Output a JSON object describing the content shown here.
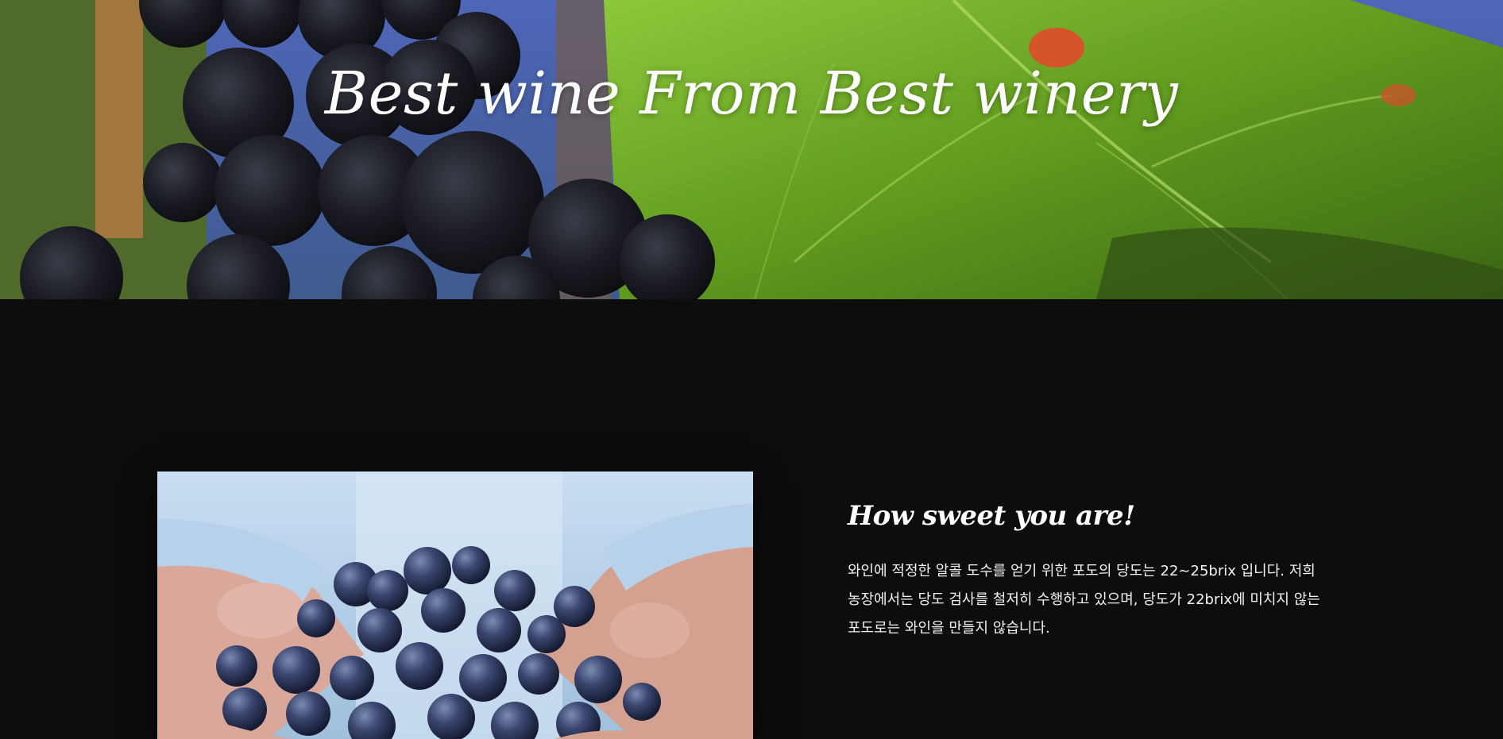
{
  "hero": {
    "title": "Best wine From Best winery"
  },
  "feature": {
    "heading": "How sweet you are!",
    "body": "와인에 적정한 알콜 도수를 얻기 위한 포도의 당도는 22~25brix 입니다. 저희 농장에서는 당도 검사를 철저히 수행하고 있으며, 당도가 22brix에 미치지 않는 포도로는 와인을 만들지 않습니다."
  },
  "colors": {
    "page_background": "#0d0d0e",
    "text": "#ffffff"
  }
}
